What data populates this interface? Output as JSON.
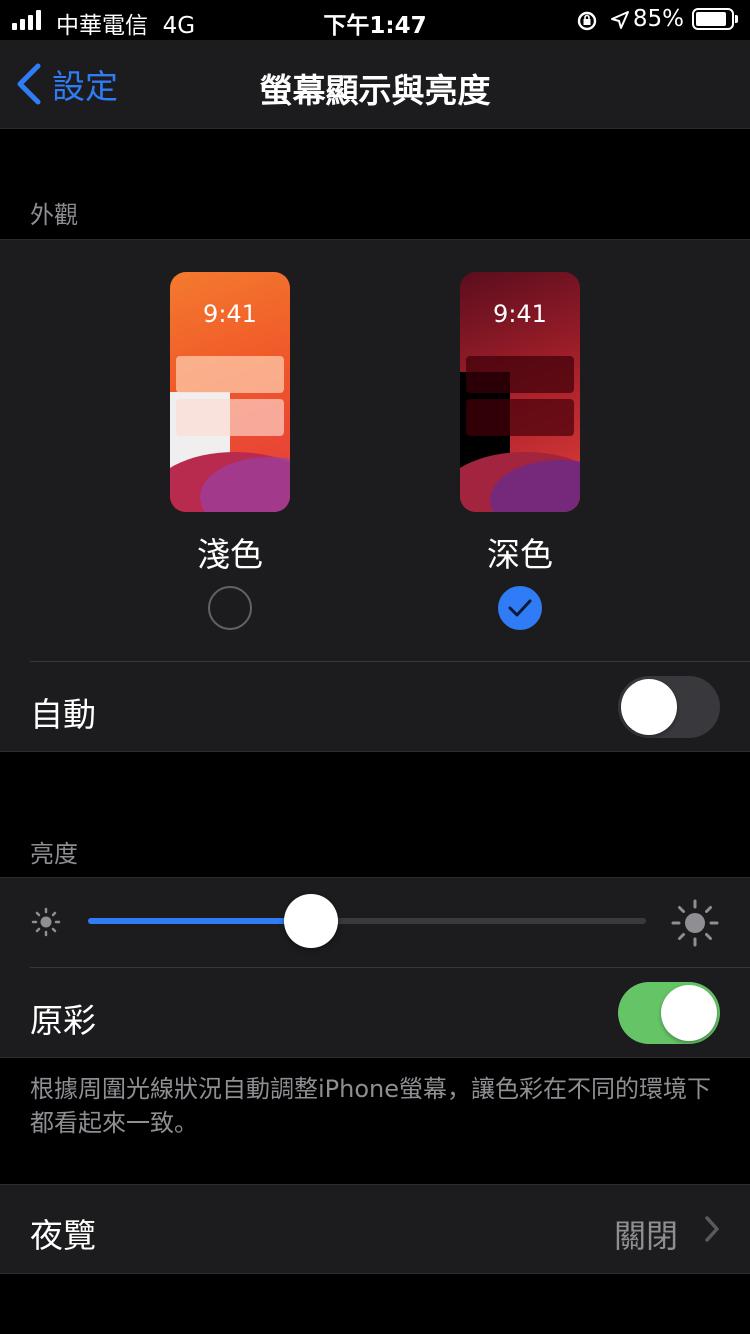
{
  "status_bar": {
    "carrier": "中華電信",
    "network": "4G",
    "time": "下午1:47",
    "battery": "85%"
  },
  "nav": {
    "back_label": "設定",
    "title": "螢幕顯示與亮度"
  },
  "appearance": {
    "header": "外觀",
    "light": {
      "preview_time": "9:41",
      "label": "淺色",
      "selected": false
    },
    "dark": {
      "preview_time": "9:41",
      "label": "深色",
      "selected": true
    },
    "auto_label": "自動",
    "auto_on": false
  },
  "brightness": {
    "header": "亮度",
    "level": 0.4,
    "true_tone_label": "原彩",
    "true_tone_on": true,
    "footer": "根據周圍光線狀況自動調整iPhone螢幕，讓色彩在不同的環境下都看起來一致。"
  },
  "night_shift": {
    "label": "夜覽",
    "value": "關閉"
  },
  "colors": {
    "accent": "#2f7cf6",
    "toggle_on": "#65c466",
    "toggle_off": "#39393d"
  }
}
